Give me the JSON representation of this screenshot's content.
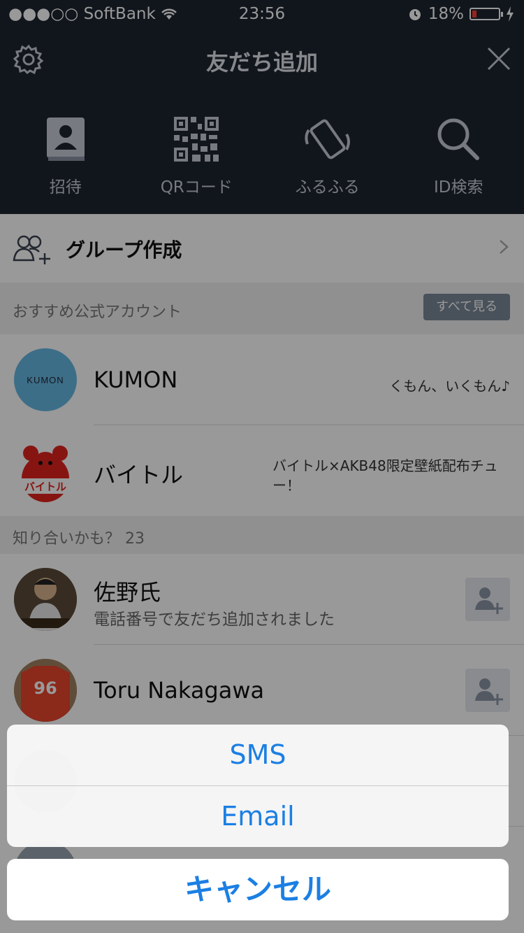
{
  "status_bar": {
    "carrier": "●●●○○ SoftBank",
    "time": "23:56",
    "battery_text": "18%"
  },
  "navbar": {
    "title": "友だち追加"
  },
  "tools": [
    {
      "label": "招待",
      "icon": "contact-book-icon"
    },
    {
      "label": "QRコード",
      "icon": "qr-code-icon"
    },
    {
      "label": "ふるふる",
      "icon": "shake-phone-icon"
    },
    {
      "label": "ID検索",
      "icon": "search-icon"
    }
  ],
  "group_row": {
    "label": "グループ作成",
    "icon": "add-group-icon"
  },
  "recommended_section": {
    "title": "おすすめ公式アカウント",
    "see_all": "すべて見る"
  },
  "official_accounts": [
    {
      "name": "KUMON",
      "logo_text": "KUMON",
      "description": "くもん、いくもん♪"
    },
    {
      "name": "バイトル",
      "logo_text": "バイトル",
      "description": "バイトル×AKB48限定壁紙配布チュー！"
    }
  ],
  "maybe_section": {
    "title": "知り合いかも？ 23"
  },
  "suggested": [
    {
      "name": "佐野氏",
      "subtitle": "電話番号で友だち追加されました"
    },
    {
      "name": "Toru Nakagawa",
      "subtitle": "",
      "jersey_number": "96"
    }
  ],
  "action_sheet": {
    "options": [
      "SMS",
      "Email"
    ],
    "cancel": "キャンセル"
  },
  "colors": {
    "header_bg": "#1d2330",
    "accent_blue": "#1b7fe3",
    "battery_red": "#ff3b30"
  }
}
